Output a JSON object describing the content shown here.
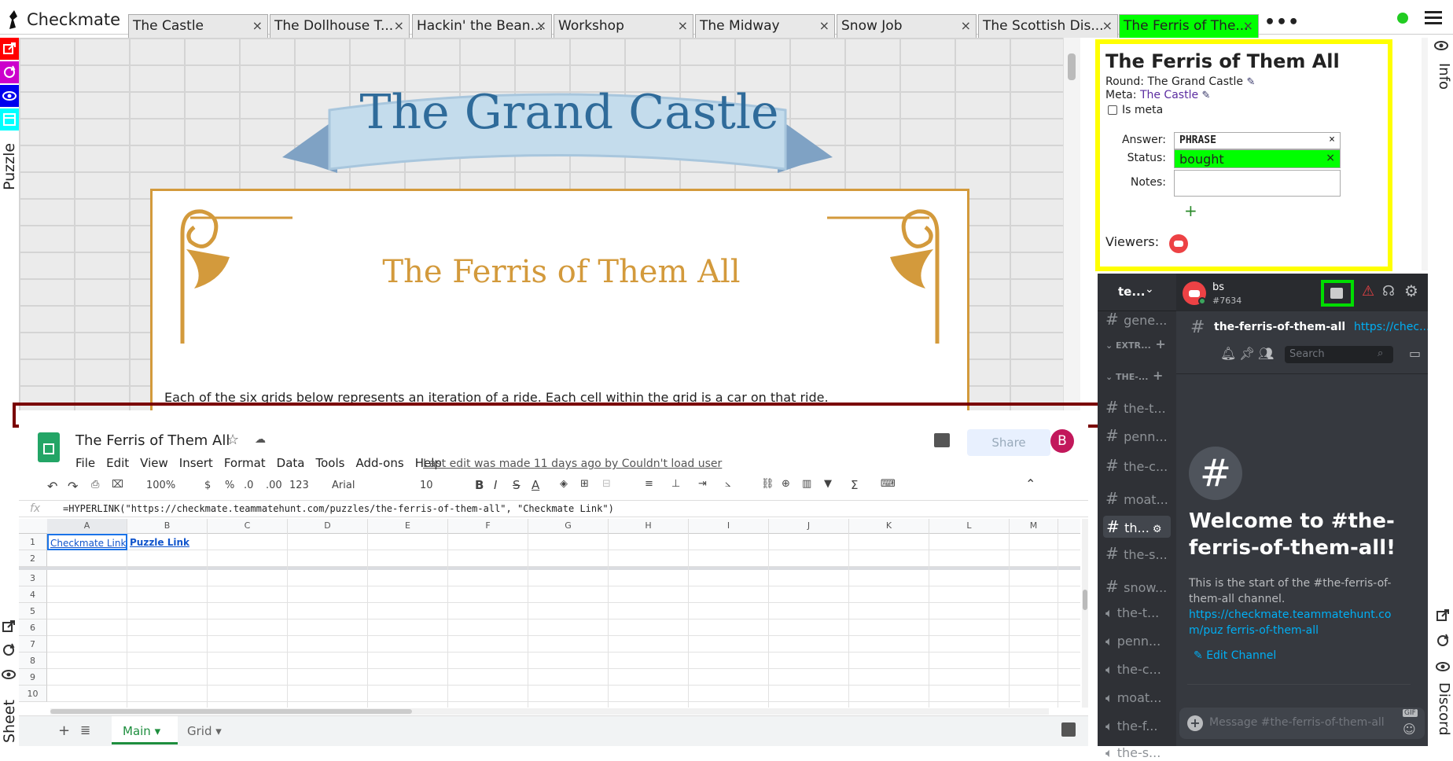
{
  "app": {
    "title": "Checkmate"
  },
  "tabs": [
    {
      "label": "The Castle",
      "active": false
    },
    {
      "label": "The Dollhouse T...",
      "active": false
    },
    {
      "label": "Hackin' the Bean...",
      "active": false
    },
    {
      "label": "Workshop",
      "active": false
    },
    {
      "label": "The Midway",
      "active": false
    },
    {
      "label": "Snow Job",
      "active": false
    },
    {
      "label": "The Scottish Dis...",
      "active": false
    },
    {
      "label": "The Ferris of The...",
      "active": true
    }
  ],
  "tab_close": "×",
  "more_label": "•••",
  "left_rail": {
    "label": "Puzzle",
    "sheet_label": "Sheet"
  },
  "puzzle_page": {
    "banner_title": "The Grand Castle",
    "card_title": "The Ferris of Them All",
    "intro_text": "Each of the six grids below represents an iteration of a ride. Each cell within the grid is a car on that ride."
  },
  "sheet": {
    "doc_title": "The Ferris of Them All",
    "menus": [
      "File",
      "Edit",
      "View",
      "Insert",
      "Format",
      "Data",
      "Tools",
      "Add-ons",
      "Help"
    ],
    "last_edit": "Last edit was made 11 days ago by Couldn't load user",
    "share_label": "Share",
    "avatar_initial": "B",
    "zoom": "100%",
    "currency": "$",
    "percent": "%",
    "dec_less": ".0",
    "dec_more": ".00",
    "number_format": "123",
    "font": "Arial",
    "font_size": "10",
    "fx_label": "fx",
    "formula": "=HYPERLINK(\"https://checkmate.teammatehunt.com/puzzles/the-ferris-of-them-all\", \"Checkmate Link\")",
    "columns": [
      "A",
      "B",
      "C",
      "D",
      "E",
      "F",
      "G",
      "H",
      "I",
      "J",
      "K",
      "L",
      "M"
    ],
    "rows": [
      "1",
      "2",
      "3",
      "4",
      "5",
      "6",
      "7",
      "8",
      "9",
      "10"
    ],
    "cell_a1": "Checkmate Link",
    "cell_b1": "Puzzle Link",
    "tabs": [
      {
        "label": "Main"
      },
      {
        "label": "Grid"
      }
    ]
  },
  "info": {
    "title": "The Ferris of Them All",
    "round_label": "Round:",
    "round_value": "The Grand Castle",
    "meta_label": "Meta:",
    "meta_value": "The Castle",
    "is_meta_label": "Is meta",
    "answer_label": "Answer:",
    "answer_value": "PHRASE",
    "status_label": "Status:",
    "status_value": "bought",
    "notes_label": "Notes:",
    "add_symbol": "+",
    "viewers_label": "Viewers:",
    "side_label": "Info"
  },
  "discord": {
    "server_name": "te...",
    "user_name": "bs",
    "user_tag": "#7634",
    "channel_name": "the-ferris-of-them-all",
    "channel_link": "https://chec...",
    "search_placeholder": "Search",
    "sidebar_channels": [
      {
        "name": "gene...",
        "type": "text"
      },
      {
        "name": "EXTR...",
        "type": "category"
      },
      {
        "name": "THE-...",
        "type": "category"
      },
      {
        "name": "the-t...",
        "type": "text"
      },
      {
        "name": "penn...",
        "type": "text"
      },
      {
        "name": "the-c...",
        "type": "text"
      },
      {
        "name": "moat...",
        "type": "text"
      },
      {
        "name": "th...",
        "type": "text-active"
      },
      {
        "name": "the-s...",
        "type": "text"
      },
      {
        "name": "snow...",
        "type": "text"
      },
      {
        "name": "the-t...",
        "type": "voice"
      },
      {
        "name": "penn...",
        "type": "voice"
      },
      {
        "name": "the-c...",
        "type": "voice"
      },
      {
        "name": "moat...",
        "type": "voice"
      },
      {
        "name": "the-f...",
        "type": "voice"
      },
      {
        "name": "the-s...",
        "type": "voice"
      }
    ],
    "welcome_title": "Welcome to #the-ferris-of-them-all!",
    "welcome_text": "This is the start of the #the-ferris-of-them-all channel.",
    "welcome_link": "https://checkmate.teammatehunt.com/puz ferris-of-them-all",
    "edit_channel": "Edit Channel",
    "message_placeholder": "Message #the-ferris-of-them-all",
    "gif_label": "GIF",
    "side_label": "Discord"
  },
  "colors": {
    "active_tab": "#00ff00",
    "status_bought": "#00ff00",
    "info_border": "#ffff00",
    "discord_bg": "#36393f",
    "puzzle_blue": "#2f6b9a",
    "puzzle_gold": "#d39a3c"
  }
}
